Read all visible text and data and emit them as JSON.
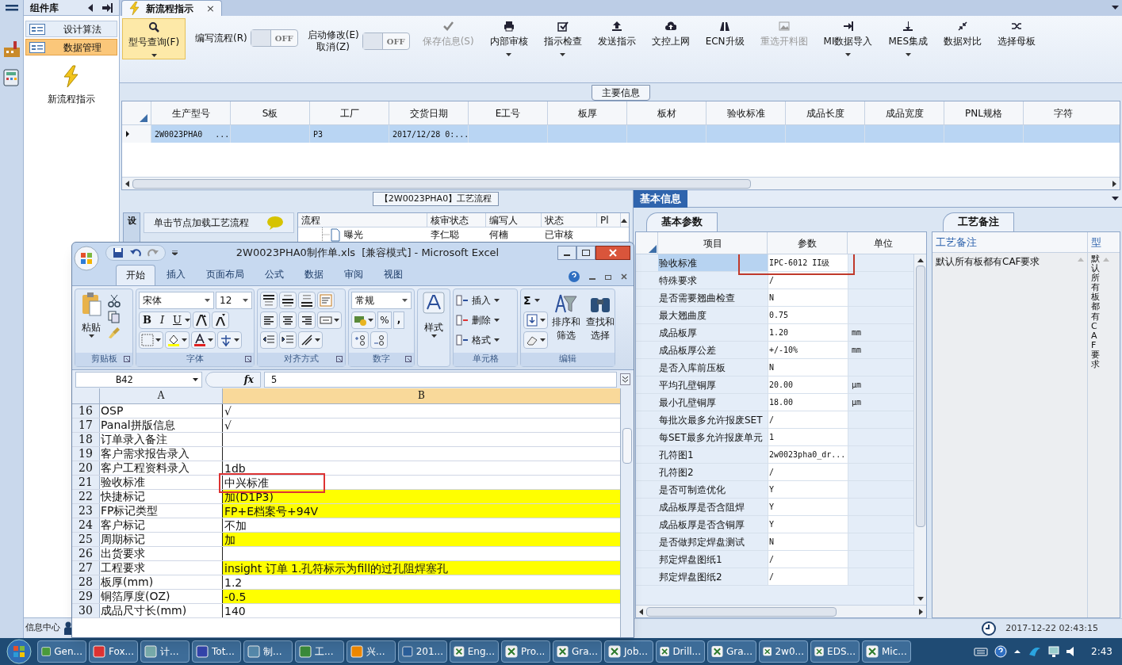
{
  "sidebar": {
    "title": "组件库",
    "items": [
      {
        "label": "设计算法",
        "selected": false
      },
      {
        "label": "数据管理",
        "selected": true
      }
    ],
    "launcher": {
      "label": "新流程指示"
    },
    "footer": "信息中心"
  },
  "document_tab": {
    "label": "新流程指示",
    "close": "×"
  },
  "toolbar": [
    {
      "kind": "button",
      "label": "型号查询(F)",
      "selected": true,
      "disabled": false,
      "dropdown": true
    },
    {
      "kind": "toggle",
      "label": "编写流程(R)",
      "on": false,
      "state": "OFF"
    },
    {
      "kind": "toggle",
      "label": "启动修改(E)\n取消(Z)",
      "on": false,
      "state": "OFF"
    },
    {
      "kind": "button",
      "label": "保存信息(S)",
      "selected": false,
      "disabled": true,
      "dropdown": false
    },
    {
      "kind": "button",
      "label": "内部审核",
      "selected": false,
      "disabled": false,
      "dropdown": true
    },
    {
      "kind": "button",
      "label": "指示检查",
      "selected": false,
      "disabled": false,
      "dropdown": true
    },
    {
      "kind": "button",
      "label": "发送指示",
      "selected": false,
      "disabled": false,
      "dropdown": false
    },
    {
      "kind": "button",
      "label": "文控上网",
      "selected": false,
      "disabled": false,
      "dropdown": false
    },
    {
      "kind": "button",
      "label": "ECN升级",
      "selected": false,
      "disabled": false,
      "dropdown": false
    },
    {
      "kind": "button",
      "label": "重选开料图",
      "selected": false,
      "disabled": true,
      "dropdown": false
    },
    {
      "kind": "button",
      "label": "MI数据导入",
      "selected": false,
      "disabled": false,
      "dropdown": true
    },
    {
      "kind": "button",
      "label": "MES集成",
      "selected": false,
      "disabled": false,
      "dropdown": true
    },
    {
      "kind": "button",
      "label": "数据对比",
      "selected": false,
      "disabled": false,
      "dropdown": false
    },
    {
      "kind": "button",
      "label": "选择母板",
      "selected": false,
      "disabled": false,
      "dropdown": false
    }
  ],
  "main_info": {
    "title": "主要信息",
    "columns": [
      "生产型号",
      "S板",
      "工厂",
      "交货日期",
      "E工号",
      "板厚",
      "板材",
      "验收标准",
      "成品长度",
      "成品宽度",
      "PNL规格",
      "字符"
    ],
    "rows": [
      {
        "selected": true,
        "cells": [
          "2W0023PHA0",
          "",
          "P3",
          "2017/12/28 0:...",
          "",
          "",
          "",
          "",
          "",
          "",
          "",
          ""
        ],
        "ellipsis": "..."
      }
    ]
  },
  "process": {
    "title": "【2W0023PHA0】工艺流程",
    "side_tab": "设",
    "load_button": "单击节点加载工艺流程",
    "columns": [
      "流程",
      "核审状态",
      "编写人",
      "状态",
      "Pl"
    ],
    "rows": [
      {
        "cells": [
          "曝光",
          "李仁聪",
          "何楠",
          "已审核"
        ]
      }
    ]
  },
  "basic_info": {
    "title": "基本信息",
    "tab": "基本参数",
    "columns": [
      "项目",
      "参数",
      "单位"
    ],
    "rows": [
      {
        "item": "验收标准",
        "value": "IPC-6012 II级",
        "unit": "",
        "selected": true,
        "annotated": true
      },
      {
        "item": "特殊要求",
        "value": "/",
        "unit": "",
        "selected": false,
        "annotated": false
      },
      {
        "item": "是否需要翘曲检查",
        "value": "N",
        "unit": "",
        "selected": false,
        "annotated": false
      },
      {
        "item": "最大翘曲度",
        "value": "0.75",
        "unit": "",
        "selected": false,
        "annotated": false
      },
      {
        "item": "成品板厚",
        "value": "1.20",
        "unit": "mm",
        "selected": false,
        "annotated": false
      },
      {
        "item": "成品板厚公差",
        "value": "+/-10%",
        "unit": "mm",
        "selected": false,
        "annotated": false
      },
      {
        "item": "是否入库前压板",
        "value": "N",
        "unit": "",
        "selected": false,
        "annotated": false
      },
      {
        "item": "平均孔壁铜厚",
        "value": "20.00",
        "unit": "μm",
        "selected": false,
        "annotated": false
      },
      {
        "item": "最小孔壁铜厚",
        "value": "18.00",
        "unit": "μm",
        "selected": false,
        "annotated": false
      },
      {
        "item": "每批次最多允许报废SET",
        "value": "/",
        "unit": "",
        "selected": false,
        "annotated": false
      },
      {
        "item": "每SET最多允许报废单元",
        "value": "1",
        "unit": "",
        "selected": false,
        "annotated": false
      },
      {
        "item": "孔符图1",
        "value": "2w0023pha0_dr...",
        "unit": "",
        "selected": false,
        "annotated": false
      },
      {
        "item": "孔符图2",
        "value": "/",
        "unit": "",
        "selected": false,
        "annotated": false
      },
      {
        "item": "是否可制造优化",
        "value": "Y",
        "unit": "",
        "selected": false,
        "annotated": false
      },
      {
        "item": "成品板厚是否含阻焊",
        "value": "Y",
        "unit": "",
        "selected": false,
        "annotated": false
      },
      {
        "item": "成品板厚是否含铜厚",
        "value": "Y",
        "unit": "",
        "selected": false,
        "annotated": false
      },
      {
        "item": "是否做邦定焊盘测试",
        "value": "N",
        "unit": "",
        "selected": false,
        "annotated": false
      },
      {
        "item": "邦定焊盘图纸1",
        "value": "/",
        "unit": "",
        "selected": false,
        "annotated": false
      },
      {
        "item": "邦定焊盘图纸2",
        "value": "/",
        "unit": "",
        "selected": false,
        "annotated": false
      }
    ]
  },
  "process_notes": {
    "tab": "工艺备注",
    "columns": [
      "工艺备注",
      "型"
    ],
    "note": "默认所有板都有CAF要求",
    "vertical_note": "默认所有板都有CAF要求"
  },
  "status_bar": {
    "time": "2017-12-22 02:43:15"
  },
  "excel": {
    "title": "2W0023PHA0制作单.xls  [兼容模式] - Microsoft Excel",
    "tabs": [
      {
        "label": "开始",
        "selected": true
      },
      {
        "label": "插入",
        "selected": false
      },
      {
        "label": "页面布局",
        "selected": false
      },
      {
        "label": "公式",
        "selected": false
      },
      {
        "label": "数据",
        "selected": false
      },
      {
        "label": "审阅",
        "selected": false
      },
      {
        "label": "视图",
        "selected": false
      }
    ],
    "ribbon": {
      "paste": "粘贴",
      "font": "宋体",
      "size": "12",
      "bold": "B",
      "italic": "I",
      "underline": "U",
      "number_format": "常规",
      "percent": "%",
      "comma": ",",
      "styles": "样式",
      "insert": "插入",
      "delete": "删除",
      "format": "格式",
      "sum": "Σ",
      "sort": "排序和筛选",
      "find": "查找和选择",
      "groups": [
        "剪贴板",
        "字体",
        "对齐方式",
        "数字",
        "单元格",
        "编辑"
      ]
    },
    "name_box": "B42",
    "fx": "fx",
    "formula": "5",
    "columns": [
      "A",
      "B"
    ],
    "rows": [
      {
        "num": "16",
        "a": "OSP",
        "b": "√",
        "yellow": false,
        "annotated": false
      },
      {
        "num": "17",
        "a": "Panal拼版信息",
        "b": "√",
        "yellow": false,
        "annotated": false
      },
      {
        "num": "18",
        "a": "订单录入备注",
        "b": "",
        "yellow": false,
        "annotated": false
      },
      {
        "num": "19",
        "a": "客户需求报告录入",
        "b": "",
        "yellow": false,
        "annotated": false
      },
      {
        "num": "20",
        "a": "客户工程资料录入",
        "b": "1db",
        "yellow": false,
        "annotated": false
      },
      {
        "num": "21",
        "a": "验收标准",
        "b": "中兴标准",
        "yellow": false,
        "annotated": true
      },
      {
        "num": "22",
        "a": "快捷标记",
        "b": "加(D1P3)",
        "yellow": true,
        "annotated": false
      },
      {
        "num": "23",
        "a": "FP标记类型",
        "b": "FP+E档案号+94V",
        "yellow": true,
        "annotated": false
      },
      {
        "num": "24",
        "a": "客户标记",
        "b": "不加",
        "yellow": false,
        "annotated": false
      },
      {
        "num": "25",
        "a": "周期标记",
        "b": "加",
        "yellow": true,
        "annotated": false
      },
      {
        "num": "26",
        "a": "出货要求",
        "b": "",
        "yellow": false,
        "annotated": false
      },
      {
        "num": "27",
        "a": "工程要求",
        "b": "insight 订单 1.孔符标示为fill的过孔阻焊塞孔",
        "yellow": true,
        "annotated": false
      },
      {
        "num": "28",
        "a": "板厚(mm)",
        "b": "1.2",
        "yellow": false,
        "annotated": false
      },
      {
        "num": "29",
        "a": "铜箔厚度(OZ)",
        "b": "-0.5",
        "yellow": true,
        "annotated": false
      },
      {
        "num": "30",
        "a": "成品尺寸长(mm)",
        "b": "140",
        "yellow": false,
        "annotated": false
      }
    ]
  },
  "taskbar": {
    "items": [
      "Gen...",
      "Fox...",
      "计...",
      "Tot...",
      "制...",
      "工...",
      "兴...",
      "201...",
      "Eng...",
      "Pro...",
      "Gra...",
      "Job...",
      "Drill...",
      "Gra...",
      "2w0...",
      "EDS...",
      "Mic..."
    ],
    "clock": "2:43"
  }
}
